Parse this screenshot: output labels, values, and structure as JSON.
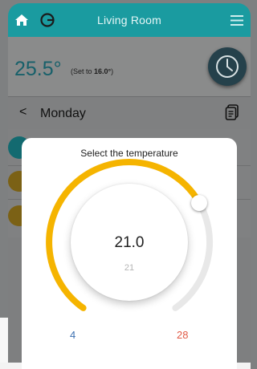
{
  "header": {
    "title": "Living Room",
    "icons": [
      "home-icon",
      "power-icon",
      "hamburger-menu-icon"
    ],
    "color": "#1a9ba0"
  },
  "status": {
    "current_temp": "25.5°",
    "set_prefix": "(Set to ",
    "set_value": "16.0°",
    "set_suffix": ")",
    "clock_icon": "clock-icon"
  },
  "day": {
    "back_label": "<",
    "label": "Monday",
    "copy_icon": "copy-icon"
  },
  "dialog": {
    "title": "Select the temperature",
    "value": "21.0",
    "sub_value": "21",
    "min_label": "4",
    "max_label": "28",
    "level": {
      "value": 21,
      "min": 4,
      "max": 28
    },
    "colors": {
      "active": "#f5b400",
      "track": "#e8e8e8",
      "min": "#3b6fb0",
      "max": "#e15b47"
    }
  }
}
